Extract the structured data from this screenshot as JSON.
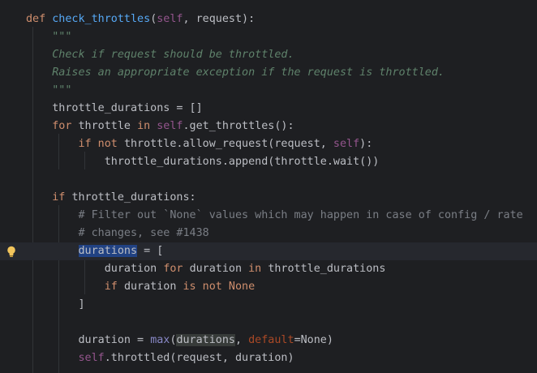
{
  "editor": {
    "language": "python",
    "colors": {
      "background": "#1e1f22",
      "keyword": "#cf8e6d",
      "function": "#56a8f5",
      "self": "#94558d",
      "docstring": "#5f826b",
      "comment": "#7a7e85",
      "selection": "#214283"
    },
    "gutter_icon": "lightbulb-icon",
    "lines": [
      {
        "i": "",
        "t": [
          [
            "kw",
            "def "
          ],
          [
            "fn",
            "check_throttles"
          ],
          [
            "",
            "("
          ],
          [
            "self",
            "self"
          ],
          [
            "",
            ", request):"
          ]
        ]
      },
      {
        "i": "    ",
        "t": [
          [
            "doc",
            "\"\"\""
          ]
        ]
      },
      {
        "i": "    ",
        "t": [
          [
            "doc",
            "Check if request should be throttled."
          ]
        ]
      },
      {
        "i": "    ",
        "t": [
          [
            "doc",
            "Raises an appropriate exception if the request is throttled."
          ]
        ]
      },
      {
        "i": "    ",
        "t": [
          [
            "doc",
            "\"\"\""
          ]
        ]
      },
      {
        "i": "    ",
        "t": [
          [
            "",
            "throttle_durations = []"
          ]
        ]
      },
      {
        "i": "    ",
        "t": [
          [
            "kw",
            "for "
          ],
          [
            "",
            "throttle "
          ],
          [
            "kw",
            "in "
          ],
          [
            "self",
            "self"
          ],
          [
            "",
            ".get_throttles():"
          ]
        ]
      },
      {
        "i": "        ",
        "t": [
          [
            "kw",
            "if not "
          ],
          [
            "",
            "throttle.allow_request(request, "
          ],
          [
            "self",
            "self"
          ],
          [
            "",
            "):"
          ]
        ]
      },
      {
        "i": "            ",
        "t": [
          [
            "",
            "throttle_durations.append(throttle.wait())"
          ]
        ]
      },
      {
        "i": "",
        "t": []
      },
      {
        "i": "    ",
        "t": [
          [
            "kw",
            "if "
          ],
          [
            "",
            "throttle_durations:"
          ]
        ]
      },
      {
        "i": "        ",
        "t": [
          [
            "cm",
            "# Filter out `None` values which may happen in case of config / rate"
          ]
        ]
      },
      {
        "i": "        ",
        "t": [
          [
            "cm",
            "# changes, see #1438"
          ]
        ]
      },
      {
        "i": "        ",
        "t": [
          [
            "sel",
            "durations"
          ],
          [
            "",
            " = ["
          ]
        ],
        "current": true
      },
      {
        "i": "            ",
        "t": [
          [
            "",
            "duration "
          ],
          [
            "kw",
            "for "
          ],
          [
            "",
            "duration "
          ],
          [
            "kw",
            "in "
          ],
          [
            "",
            "throttle_durations"
          ]
        ]
      },
      {
        "i": "            ",
        "t": [
          [
            "kw",
            "if "
          ],
          [
            "",
            "duration "
          ],
          [
            "kw",
            "is not None"
          ]
        ]
      },
      {
        "i": "        ",
        "t": [
          [
            "",
            "]"
          ]
        ]
      },
      {
        "i": "",
        "t": []
      },
      {
        "i": "        ",
        "t": [
          [
            "",
            "duration = "
          ],
          [
            "bi",
            "max"
          ],
          [
            "",
            "("
          ],
          [
            "ref",
            "durations"
          ],
          [
            "",
            ", "
          ],
          [
            "kwarg",
            "default"
          ],
          [
            "",
            "=None)"
          ]
        ]
      },
      {
        "i": "        ",
        "t": [
          [
            "self",
            "self"
          ],
          [
            "",
            ".throttled(request, duration)"
          ]
        ]
      }
    ]
  }
}
